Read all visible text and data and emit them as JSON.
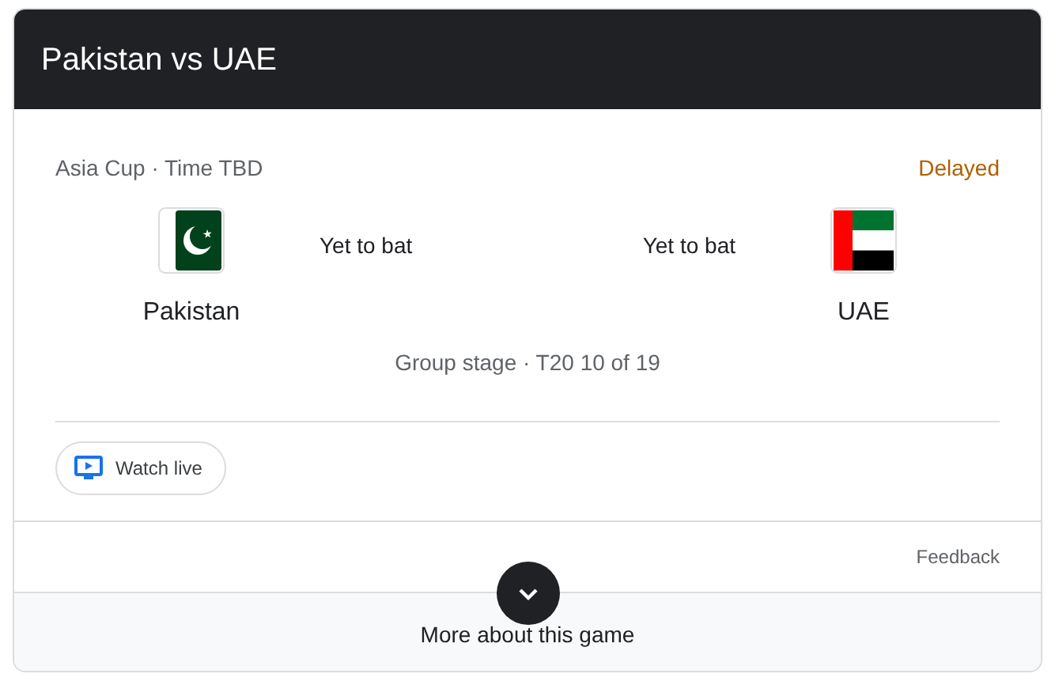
{
  "title": "Pakistan vs UAE",
  "match_info": "Asia Cup · Time TBD",
  "status": "Delayed",
  "teams": [
    {
      "name": "Pakistan",
      "score": "Yet to bat"
    },
    {
      "name": "UAE",
      "score": "Yet to bat"
    }
  ],
  "stage": "Group stage · T20 10 of 19",
  "watch_button": "Watch live",
  "feedback": "Feedback",
  "more_button": "More about this game"
}
